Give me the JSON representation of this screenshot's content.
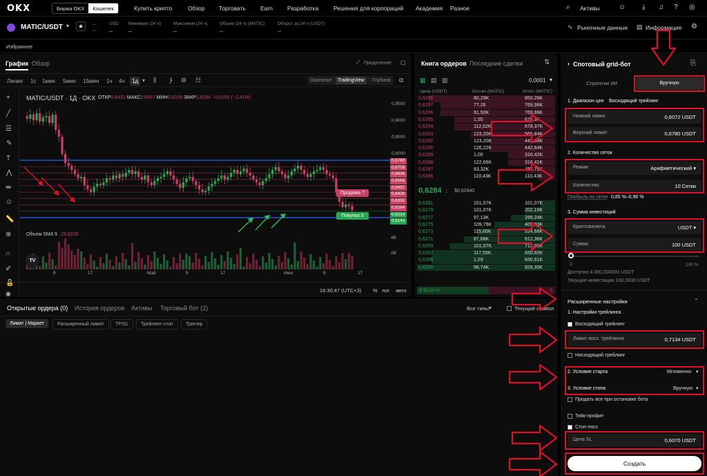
{
  "nav": {
    "logo": "OKX",
    "mode_exchange": "Биржа OKX",
    "mode_wallet": "Кошелек",
    "items": [
      "Купить крипто",
      "Обзор",
      "Торговать",
      "Earn",
      "Разработка",
      "Решения для корпораций",
      "Академия",
      "Разное"
    ],
    "assets": "Активы"
  },
  "ticker": {
    "pair": "MATIC/USDT",
    "price": "--",
    "price_sub": "--",
    "stats": [
      {
        "label": "USD",
        "value": "--"
      },
      {
        "label": "Минимум (24 ч)",
        "value": "--"
      },
      {
        "label": "Максимум (24 ч)",
        "value": "--"
      },
      {
        "label": "Объем (24 ч) (MATIC)",
        "value": "--"
      },
      {
        "label": "Оборот за 24 ч (USDT)",
        "value": "--"
      }
    ],
    "market_data": "Рыночные данные",
    "info": "Информация"
  },
  "favorites": "Избранное",
  "chart_panel": {
    "tab_chart": "График",
    "tab_overview": "Обзор",
    "expand_label": "Проделение",
    "intervals": [
      "Линия",
      "1с",
      "1мин",
      "5мин",
      "15мин",
      "1ч",
      "4ч",
      "1д"
    ],
    "view_modes": [
      "Оригинал",
      "TradingView",
      "Глубина"
    ],
    "legend": "MATIC/USDT · 1Д · OKX",
    "ohlc": {
      "o_label": "ОТКР",
      "o": "0,6431",
      "h_label": "МАКС",
      "h": "0,6457",
      "l_label": "МИН",
      "l": "0,6209",
      "c_label": "ЗАКР",
      "c": "0,6284",
      "chg": "−0,0155 (−2,41%)"
    },
    "volume_label": "Объем SMA 9",
    "volume_value": "29,822K",
    "price_axis": [
      "0,9500",
      "0,9000",
      "0,8500",
      "0,8000"
    ],
    "grid_prices": [
      "0,6780",
      "0,6709",
      "0,6638",
      "0,6568",
      "0,6497",
      "0,6426",
      "0,6355",
      "0,6284",
      "0,6214",
      "0,6143"
    ],
    "sell_label": "Продажа 7",
    "buy_label": "Покупка 3",
    "vol_axis": [
      "4B",
      "2B"
    ],
    "x_labels": [
      "9",
      "17",
      "Май",
      "9",
      "17",
      "Июн",
      "9",
      "17"
    ],
    "time": "16:30:47 (UTC+3)",
    "pct": "%",
    "log": "лог",
    "auto": "авто",
    "tv": "TV"
  },
  "orderbook": {
    "tab_book": "Книга ордеров",
    "tab_trades": "Последние сделки",
    "tick": "0,0001",
    "headers": [
      "Цена (USDT)",
      "Кол-во (MATIC)",
      "Итого (MATIC)"
    ],
    "asks": [
      [
        "0,6298",
        "80,29K",
        "850,26K"
      ],
      [
        "0,6297",
        "77,26",
        "769,96K"
      ],
      [
        "0,6296",
        "91,50K",
        "769,88K"
      ],
      [
        "0,6295",
        "1,55",
        "678,3K"
      ],
      [
        "0,6294",
        "112,52K",
        "678,37K"
      ],
      [
        "0,6293",
        "123,20K",
        "565,84K"
      ],
      [
        "0,6292",
        "123,20K",
        "442,64K"
      ],
      [
        "0,6290",
        "126,22K",
        "442,64K"
      ],
      [
        "0,6289",
        "1,00",
        "316,42K"
      ],
      [
        "0,6288",
        "122,66K",
        "316,41K"
      ],
      [
        "0,6287",
        "83,32K",
        "193,75K"
      ],
      [
        "0,6286",
        "110,43K",
        "110,43K"
      ]
    ],
    "last": "0,6284",
    "last_usd": "$0,62840",
    "bids": [
      [
        "0,6281",
        "101,07K",
        "101,07K"
      ],
      [
        "0,6279",
        "101,07K",
        "202,10K"
      ],
      [
        "0,6277",
        "97,13K",
        "299,24K"
      ],
      [
        "0,6275",
        "109,79K",
        "409,03K"
      ],
      [
        "0,6273",
        "115,65K",
        "524,68K"
      ],
      [
        "0,6271",
        "87,68K",
        "612,36K"
      ],
      [
        "0,6269",
        "101,07K",
        "713,05K"
      ],
      [
        "0,6267",
        "117,55K",
        "830,60K"
      ],
      [
        "0,6266",
        "1,03",
        "830,61K"
      ],
      [
        "0,6265",
        "98,74K",
        "929,35K"
      ]
    ],
    "buy_pct": "B 52,22 %",
    "sell_pct": "S"
  },
  "orders": {
    "tabs": [
      "Открытые ордера (0)",
      "История ордеров",
      "Активы",
      "Торговый бот (2)"
    ],
    "all_types": "Все типы",
    "current_symbol": "Текущий символ",
    "filters": [
      "Лимит | Маркет",
      "Расширенный лимит",
      "TP/SL",
      "Трейлинг-стоп",
      "Триггер"
    ]
  },
  "bot": {
    "title": "Спотовый grid-бот",
    "tab_ai": "Стратегии ИИ",
    "tab_manual": "Вручную",
    "s1": "1. Диапазон цен",
    "s1_trailing": "Восходящий трейлинг",
    "lower_label": "Нижний лимит",
    "lower_value": "0,6072",
    "lower_unit": "USDT",
    "upper_label": "Верхний лимит",
    "upper_value": "0,6780",
    "upper_unit": "USDT",
    "s2": "2. Количество сеток",
    "mode_label": "Режим",
    "mode_value": "Арифметический",
    "count_label": "Количество",
    "count_value": "10",
    "count_unit": "Сетки",
    "profit_label": "Прибыль по сетке",
    "profit_value": "0,85 %–0,96 %",
    "s3": "3. Сумма инвестиций",
    "crypto_label": "Криптовалюта",
    "crypto_value": "USDT",
    "amount_label": "Сумма",
    "amount_value": "100",
    "amount_unit": "USDT",
    "slider_min": "0",
    "slider_max": "100 %",
    "available": "Доступно 4 000,000000 USDT",
    "current_inv": "Текущие инвестиции 100,0000 USDT",
    "advanced": "Расширенные настройки",
    "trailing_settings": "1. Настройки трейлинга",
    "up_trailing": "Восходящий трейлинг",
    "up_trailing_limit_label": "Лимит восх. трейлинга",
    "up_trailing_limit_value": "0,7134",
    "up_trailing_unit": "USDT",
    "down_trailing": "Нисходящий трейлинг",
    "start_cond": "2. Условие старта",
    "start_value": "Мгновенно",
    "stop_cond": "3. Условие стопа",
    "stop_value": "Вручную",
    "sell_all": "Продать все при остановке бота",
    "tp": "Тейк-профит",
    "sl": "Стоп-лосс",
    "sl_label": "Цена SL",
    "sl_value": "0,6070",
    "sl_unit": "USDT",
    "create": "Создать"
  },
  "colors": {
    "up": "#25a750",
    "down": "#ca3f64",
    "accent_red": "#e0102a",
    "blue_line": "#2962ff"
  }
}
